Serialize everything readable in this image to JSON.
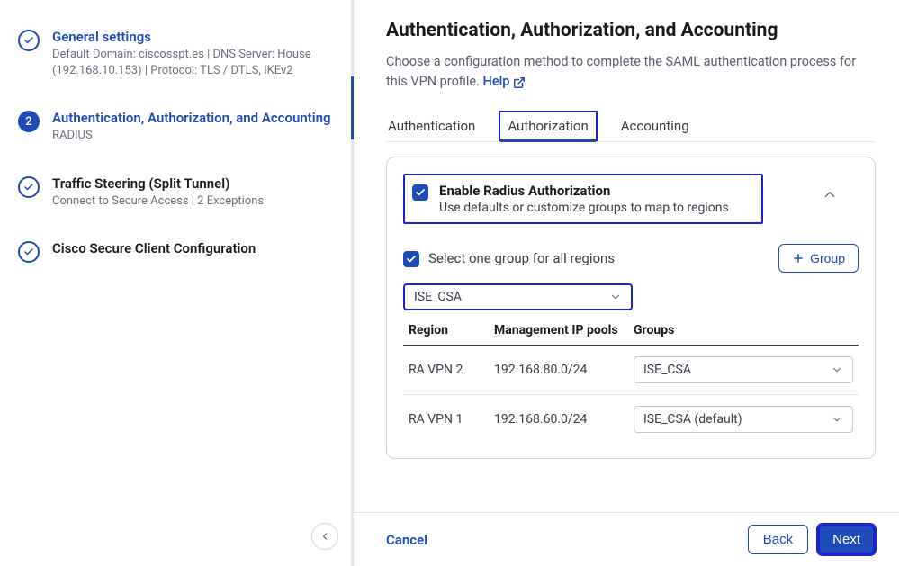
{
  "sidebar": {
    "steps": [
      {
        "title": "General settings",
        "sub": "Default Domain: ciscosspt.es | DNS Server: House (192.168.10.153) | Protocol: TLS / DTLS, IKEv2"
      },
      {
        "num": "2",
        "title": "Authentication, Authorization, and Accounting",
        "sub": "RADIUS"
      },
      {
        "title": "Traffic Steering (Split Tunnel)",
        "sub": "Connect to Secure Access | 2 Exceptions"
      },
      {
        "title": "Cisco Secure Client Configuration",
        "sub": ""
      }
    ]
  },
  "main": {
    "title": "Authentication, Authorization, and Accounting",
    "desc": "Choose a configuration method to complete the SAML authentication process for this VPN profile.",
    "help_label": "Help",
    "tabs": {
      "auth": "Authentication",
      "authz": "Authorization",
      "acct": "Accounting"
    },
    "enable": {
      "title": "Enable Radius Authorization",
      "desc": "Use defaults or customize groups to map to regions"
    },
    "select_all_label": "Select one group for all regions",
    "group_btn": "Group",
    "group_select_value": "ISE_CSA",
    "table": {
      "cols": {
        "region": "Region",
        "ip": "Management IP pools",
        "groups": "Groups"
      },
      "rows": [
        {
          "region": "RA VPN 2",
          "ip": "192.168.80.0/24",
          "group": "ISE_CSA"
        },
        {
          "region": "RA VPN 1",
          "ip": "192.168.60.0/24",
          "group": "ISE_CSA (default)"
        }
      ]
    }
  },
  "footer": {
    "cancel": "Cancel",
    "back": "Back",
    "next": "Next"
  }
}
